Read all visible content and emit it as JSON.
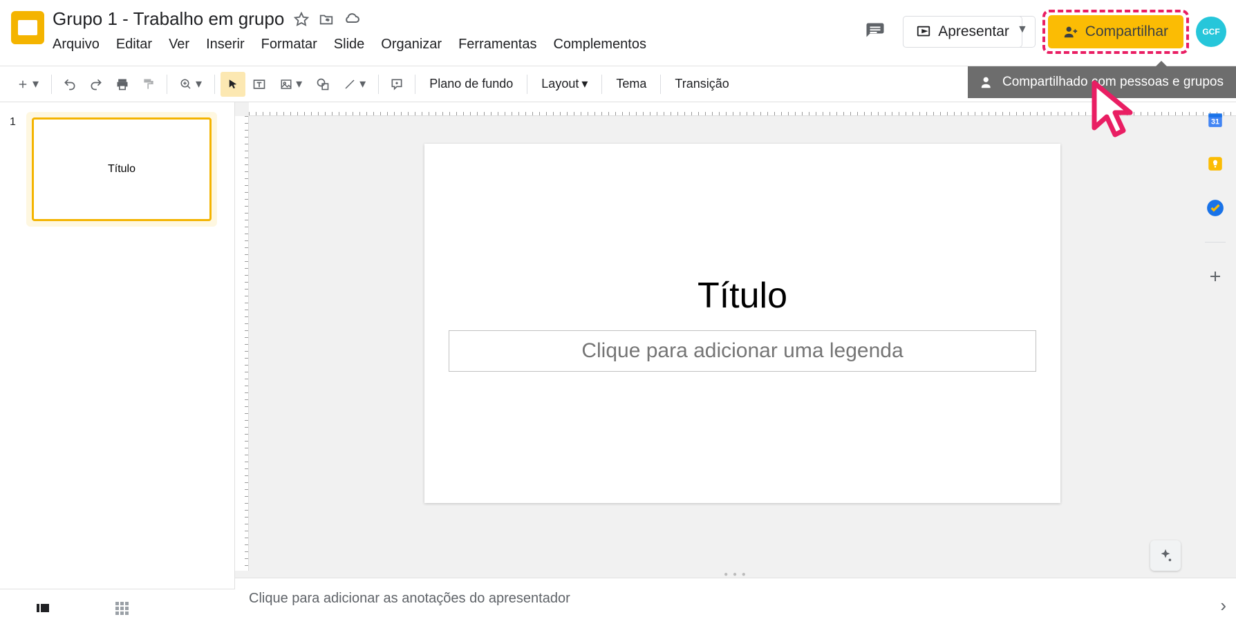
{
  "header": {
    "doc_title": "Grupo 1 - Trabalho em grupo",
    "present_label": "Apresentar",
    "share_label": "Compartilhar",
    "share_tooltip": "Compartilhado com pessoas e grupos",
    "avatar_label": "GCF"
  },
  "menubar": [
    "Arquivo",
    "Editar",
    "Ver",
    "Inserir",
    "Formatar",
    "Slide",
    "Organizar",
    "Ferramentas",
    "Complementos"
  ],
  "toolbar": {
    "background_label": "Plano de fundo",
    "layout_label": "Layout",
    "theme_label": "Tema",
    "transition_label": "Transição"
  },
  "thumbnails": [
    {
      "number": "1",
      "title": "Título"
    }
  ],
  "slide": {
    "title": "Título",
    "subtitle_placeholder": "Clique para adicionar uma legenda"
  },
  "notes_placeholder": "Clique para adicionar as anotações do apresentador"
}
